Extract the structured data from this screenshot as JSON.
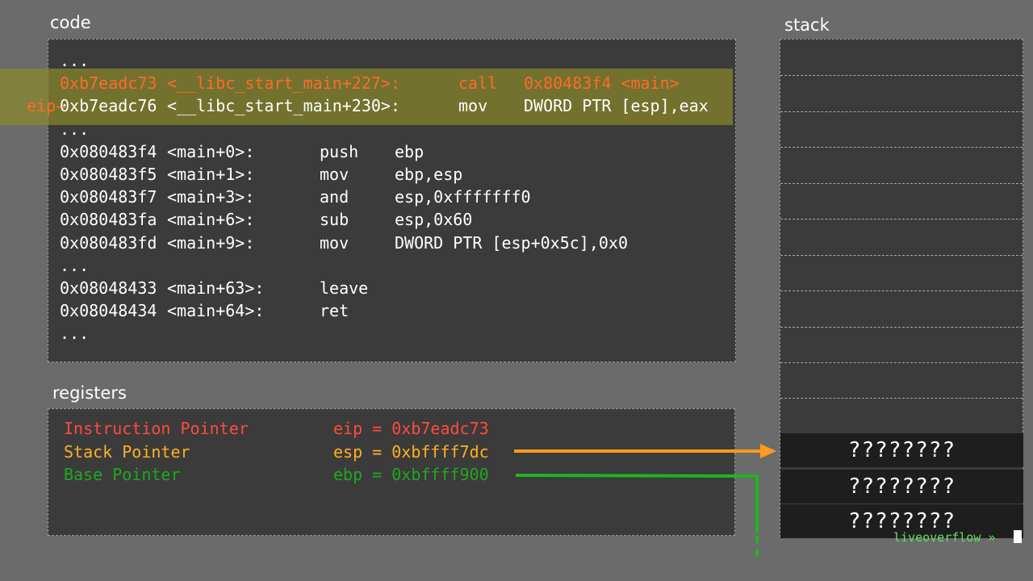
{
  "code": {
    "title": "code",
    "eip_marker": "eip",
    "lines": [
      {
        "addr": "...",
        "sym": "",
        "op": "",
        "args": ""
      },
      {
        "addr": "0xb7eadc73",
        "sym": "<__libc_start_main+227>:",
        "op": "call",
        "args": "0x80483f4 <main>"
      },
      {
        "addr": "0xb7eadc76",
        "sym": "<__libc_start_main+230>:",
        "op": "mov",
        "args": "DWORD PTR [esp],eax"
      },
      {
        "addr": "...",
        "sym": "",
        "op": "",
        "args": ""
      },
      {
        "addr": "0x080483f4",
        "sym": "<main+0>:",
        "op": "push",
        "args": "ebp"
      },
      {
        "addr": "0x080483f5",
        "sym": "<main+1>:",
        "op": "mov",
        "args": "ebp,esp"
      },
      {
        "addr": "0x080483f7",
        "sym": "<main+3>:",
        "op": "and",
        "args": "esp,0xfffffff0"
      },
      {
        "addr": "0x080483fa",
        "sym": "<main+6>:",
        "op": "sub",
        "args": "esp,0x60"
      },
      {
        "addr": "0x080483fd",
        "sym": "<main+9>:",
        "op": "mov",
        "args": "DWORD PTR [esp+0x5c],0x0"
      },
      {
        "addr": "...",
        "sym": "",
        "op": "",
        "args": ""
      },
      {
        "addr": "0x08048433",
        "sym": "<main+63>:",
        "op": "leave",
        "args": ""
      },
      {
        "addr": "0x08048434",
        "sym": "<main+64>:",
        "op": "ret",
        "args": ""
      },
      {
        "addr": "...",
        "sym": "",
        "op": "",
        "args": ""
      }
    ]
  },
  "registers": {
    "title": "registers",
    "items": [
      {
        "name": "Instruction Pointer",
        "expr": "eip = 0xb7eadc73",
        "color": "#ff4b3e"
      },
      {
        "name": "Stack Pointer",
        "expr": "esp = 0xbffff7dc",
        "color": "#ffb020"
      },
      {
        "name": "Base Pointer",
        "expr": "ebp = 0xbffff900",
        "color": "#1fa81f"
      }
    ]
  },
  "stack": {
    "title": "stack",
    "values": [
      "????????",
      "????????",
      "????????"
    ]
  },
  "colors": {
    "eip": "#ff6a2a",
    "esp_arrow": "#ff9a1a",
    "ebp_arrow": "#1fb51f"
  },
  "watermark": "liveoverflow »"
}
